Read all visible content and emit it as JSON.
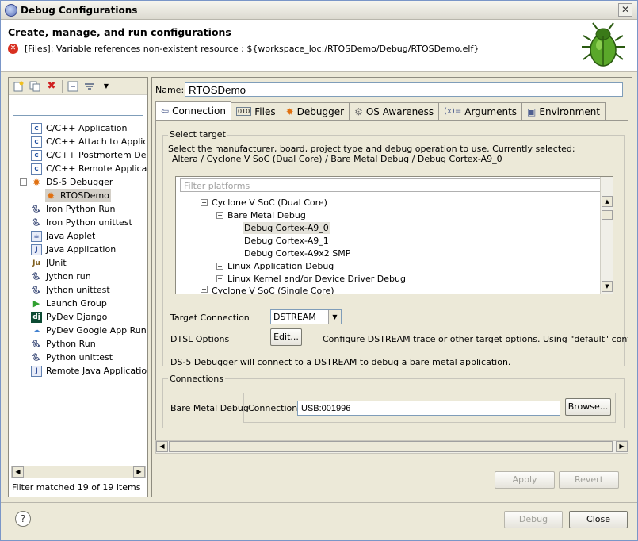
{
  "window": {
    "title": "Debug Configurations"
  },
  "header": {
    "title": "Create, manage, and run configurations",
    "error": "[Files]: Variable references non-existent resource : ${workspace_loc:/RTOSDemo/Debug/RTOSDemo.elf}"
  },
  "left": {
    "filter_value": "",
    "tree": [
      {
        "label": "C/C++ Application",
        "icon": "c-icon"
      },
      {
        "label": "C/C++ Attach to Applicat",
        "icon": "c-icon"
      },
      {
        "label": "C/C++ Postmortem Debu",
        "icon": "c-icon"
      },
      {
        "label": "C/C++ Remote Applicatio",
        "icon": "c-icon"
      },
      {
        "label": "DS-5 Debugger",
        "icon": "ds5-icon"
      },
      {
        "label": "RTOSDemo",
        "icon": "ds5-icon"
      },
      {
        "label": "Iron Python Run",
        "icon": "python-icon"
      },
      {
        "label": "Iron Python unittest",
        "icon": "python-unittest-icon"
      },
      {
        "label": "Java Applet",
        "icon": "applet-icon"
      },
      {
        "label": "Java Application",
        "icon": "java-icon"
      },
      {
        "label": "JUnit",
        "icon": "junit-icon"
      },
      {
        "label": "Jython run",
        "icon": "python-icon"
      },
      {
        "label": "Jython unittest",
        "icon": "python-unittest-icon"
      },
      {
        "label": "Launch Group",
        "icon": "launch-icon"
      },
      {
        "label": "PyDev Django",
        "icon": "django-icon"
      },
      {
        "label": "PyDev Google App Run",
        "icon": "google-icon"
      },
      {
        "label": "Python Run",
        "icon": "python-icon"
      },
      {
        "label": "Python unittest",
        "icon": "python-unittest-icon"
      },
      {
        "label": "Remote Java Application",
        "icon": "remote-java-icon"
      }
    ],
    "status": "Filter matched 19 of 19 items"
  },
  "right": {
    "name_label": "Name:",
    "name_value": "RTOSDemo",
    "tabs": [
      "Connection",
      "Files",
      "Debugger",
      "OS Awareness",
      "Arguments",
      "Environment"
    ],
    "select_target": {
      "label": "Select target",
      "desc1": "Select the manufacturer, board, project type and debug operation to use. Currently selected:",
      "desc2": "Altera / Cyclone V SoC (Dual Core) / Bare Metal Debug / Debug Cortex-A9_0",
      "filter_placeholder": "Filter platforms",
      "nodes": [
        "Cyclone V SoC (Dual Core)",
        "Bare Metal Debug",
        "Debug Cortex-A9_0",
        "Debug Cortex-A9_1",
        "Debug Cortex-A9x2 SMP",
        "Linux Application Debug",
        "Linux Kernel and/or Device Driver Debug",
        "Cyclone V SoC (Single Core)"
      ]
    },
    "target_connection_label": "Target Connection",
    "target_connection_value": "DSTREAM",
    "dtsl_label": "DTSL Options",
    "edit_button": "Edit...",
    "dtsl_desc": "Configure DSTREAM trace or other target options. Using \"default\" configuratio",
    "info": "DS-5 Debugger will connect to a DSTREAM to debug a bare metal application.",
    "connections": {
      "label": "Connections",
      "bare_metal": "Bare Metal Debug",
      "connection_label": "Connection",
      "connection_value": "USB:001996",
      "browse": "Browse..."
    },
    "apply": "Apply",
    "revert": "Revert"
  },
  "footer": {
    "debug": "Debug",
    "close": "Close",
    "help": "?"
  }
}
